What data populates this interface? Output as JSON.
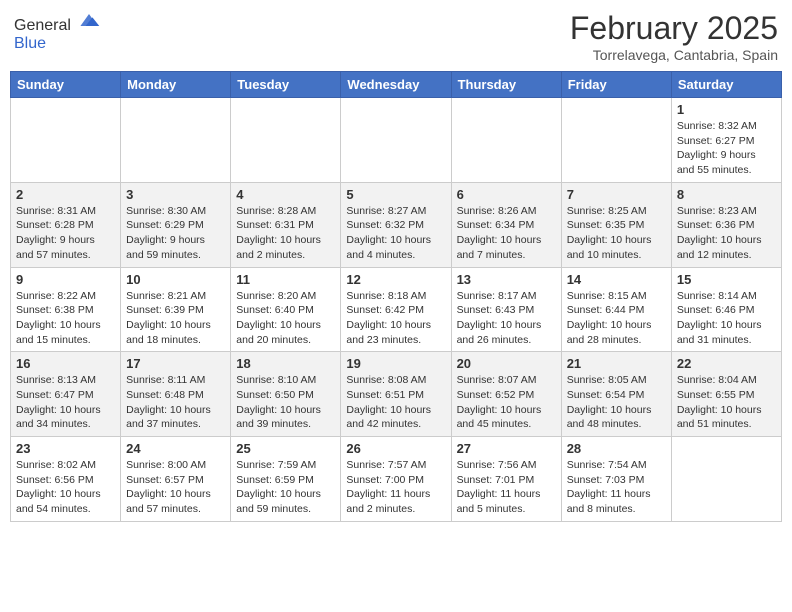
{
  "header": {
    "logo_general": "General",
    "logo_blue": "Blue",
    "month_title": "February 2025",
    "location": "Torrelavega, Cantabria, Spain"
  },
  "days_of_week": [
    "Sunday",
    "Monday",
    "Tuesday",
    "Wednesday",
    "Thursday",
    "Friday",
    "Saturday"
  ],
  "weeks": [
    [
      {
        "day": "",
        "info": ""
      },
      {
        "day": "",
        "info": ""
      },
      {
        "day": "",
        "info": ""
      },
      {
        "day": "",
        "info": ""
      },
      {
        "day": "",
        "info": ""
      },
      {
        "day": "",
        "info": ""
      },
      {
        "day": "1",
        "info": "Sunrise: 8:32 AM\nSunset: 6:27 PM\nDaylight: 9 hours\nand 55 minutes."
      }
    ],
    [
      {
        "day": "2",
        "info": "Sunrise: 8:31 AM\nSunset: 6:28 PM\nDaylight: 9 hours\nand 57 minutes."
      },
      {
        "day": "3",
        "info": "Sunrise: 8:30 AM\nSunset: 6:29 PM\nDaylight: 9 hours\nand 59 minutes."
      },
      {
        "day": "4",
        "info": "Sunrise: 8:28 AM\nSunset: 6:31 PM\nDaylight: 10 hours\nand 2 minutes."
      },
      {
        "day": "5",
        "info": "Sunrise: 8:27 AM\nSunset: 6:32 PM\nDaylight: 10 hours\nand 4 minutes."
      },
      {
        "day": "6",
        "info": "Sunrise: 8:26 AM\nSunset: 6:34 PM\nDaylight: 10 hours\nand 7 minutes."
      },
      {
        "day": "7",
        "info": "Sunrise: 8:25 AM\nSunset: 6:35 PM\nDaylight: 10 hours\nand 10 minutes."
      },
      {
        "day": "8",
        "info": "Sunrise: 8:23 AM\nSunset: 6:36 PM\nDaylight: 10 hours\nand 12 minutes."
      }
    ],
    [
      {
        "day": "9",
        "info": "Sunrise: 8:22 AM\nSunset: 6:38 PM\nDaylight: 10 hours\nand 15 minutes."
      },
      {
        "day": "10",
        "info": "Sunrise: 8:21 AM\nSunset: 6:39 PM\nDaylight: 10 hours\nand 18 minutes."
      },
      {
        "day": "11",
        "info": "Sunrise: 8:20 AM\nSunset: 6:40 PM\nDaylight: 10 hours\nand 20 minutes."
      },
      {
        "day": "12",
        "info": "Sunrise: 8:18 AM\nSunset: 6:42 PM\nDaylight: 10 hours\nand 23 minutes."
      },
      {
        "day": "13",
        "info": "Sunrise: 8:17 AM\nSunset: 6:43 PM\nDaylight: 10 hours\nand 26 minutes."
      },
      {
        "day": "14",
        "info": "Sunrise: 8:15 AM\nSunset: 6:44 PM\nDaylight: 10 hours\nand 28 minutes."
      },
      {
        "day": "15",
        "info": "Sunrise: 8:14 AM\nSunset: 6:46 PM\nDaylight: 10 hours\nand 31 minutes."
      }
    ],
    [
      {
        "day": "16",
        "info": "Sunrise: 8:13 AM\nSunset: 6:47 PM\nDaylight: 10 hours\nand 34 minutes."
      },
      {
        "day": "17",
        "info": "Sunrise: 8:11 AM\nSunset: 6:48 PM\nDaylight: 10 hours\nand 37 minutes."
      },
      {
        "day": "18",
        "info": "Sunrise: 8:10 AM\nSunset: 6:50 PM\nDaylight: 10 hours\nand 39 minutes."
      },
      {
        "day": "19",
        "info": "Sunrise: 8:08 AM\nSunset: 6:51 PM\nDaylight: 10 hours\nand 42 minutes."
      },
      {
        "day": "20",
        "info": "Sunrise: 8:07 AM\nSunset: 6:52 PM\nDaylight: 10 hours\nand 45 minutes."
      },
      {
        "day": "21",
        "info": "Sunrise: 8:05 AM\nSunset: 6:54 PM\nDaylight: 10 hours\nand 48 minutes."
      },
      {
        "day": "22",
        "info": "Sunrise: 8:04 AM\nSunset: 6:55 PM\nDaylight: 10 hours\nand 51 minutes."
      }
    ],
    [
      {
        "day": "23",
        "info": "Sunrise: 8:02 AM\nSunset: 6:56 PM\nDaylight: 10 hours\nand 54 minutes."
      },
      {
        "day": "24",
        "info": "Sunrise: 8:00 AM\nSunset: 6:57 PM\nDaylight: 10 hours\nand 57 minutes."
      },
      {
        "day": "25",
        "info": "Sunrise: 7:59 AM\nSunset: 6:59 PM\nDaylight: 10 hours\nand 59 minutes."
      },
      {
        "day": "26",
        "info": "Sunrise: 7:57 AM\nSunset: 7:00 PM\nDaylight: 11 hours\nand 2 minutes."
      },
      {
        "day": "27",
        "info": "Sunrise: 7:56 AM\nSunset: 7:01 PM\nDaylight: 11 hours\nand 5 minutes."
      },
      {
        "day": "28",
        "info": "Sunrise: 7:54 AM\nSunset: 7:03 PM\nDaylight: 11 hours\nand 8 minutes."
      },
      {
        "day": "",
        "info": ""
      }
    ]
  ]
}
